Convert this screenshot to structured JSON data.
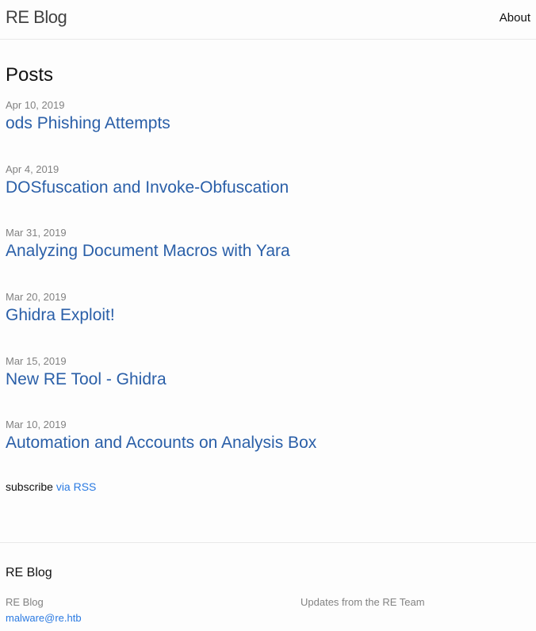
{
  "header": {
    "site_title": "RE Blog",
    "nav_about": "About"
  },
  "main": {
    "heading": "Posts",
    "posts": [
      {
        "date": "Apr 10, 2019",
        "title": "ods Phishing Attempts"
      },
      {
        "date": "Apr 4, 2019",
        "title": "DOSfuscation and Invoke-Obfuscation"
      },
      {
        "date": "Mar 31, 2019",
        "title": "Analyzing Document Macros with Yara"
      },
      {
        "date": "Mar 20, 2019",
        "title": "Ghidra Exploit!"
      },
      {
        "date": "Mar 15, 2019",
        "title": "New RE Tool - Ghidra"
      },
      {
        "date": "Mar 10, 2019",
        "title": "Automation and Accounts on Analysis Box"
      }
    ],
    "subscribe_text": "subscribe",
    "subscribe_link": "via RSS"
  },
  "footer": {
    "heading": "RE Blog",
    "name": "RE Blog",
    "email": "malware@re.htb",
    "description": "Updates from the RE Team"
  },
  "colors": {
    "link": "#2a5fa8",
    "accent_link": "#2a7ae2",
    "meta_text": "#828282",
    "divider": "#e8e8e8"
  }
}
